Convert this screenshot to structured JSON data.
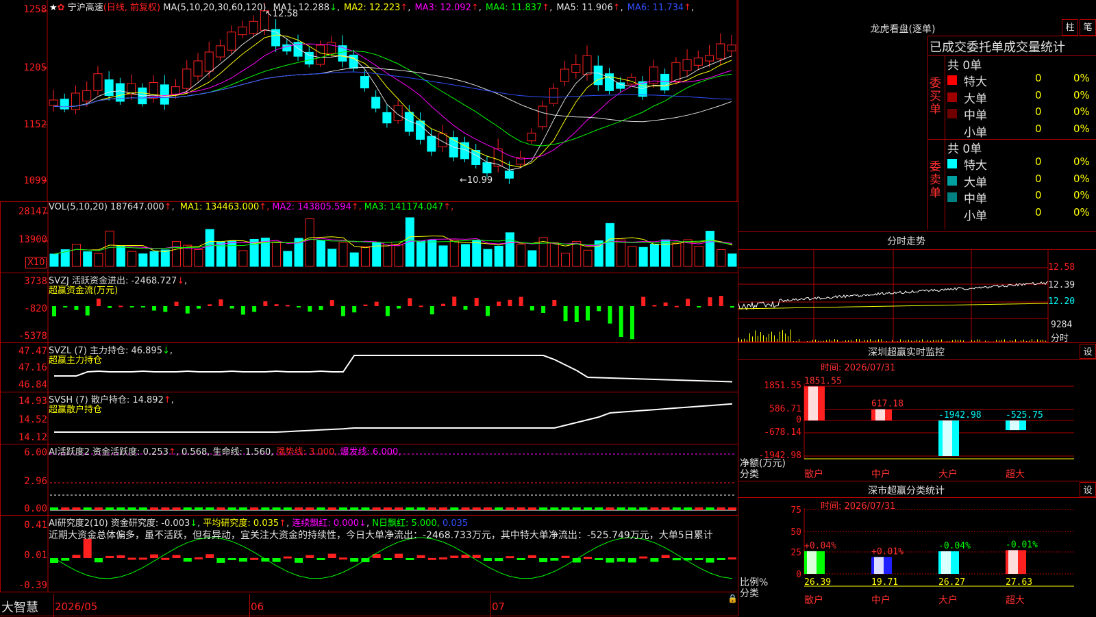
{
  "stock": {
    "name": "宁沪高速",
    "mode": "(日线, 前复权)",
    "ma_label": "MA(5,10,20,30,60,120)",
    "ma": [
      {
        "label": "MA1: 12.288",
        "arrow": "↓",
        "color": "#e0e0e0"
      },
      {
        "label": "MA2: 12.223",
        "arrow": "↑",
        "color": "#ffff00"
      },
      {
        "label": "MA3: 12.092",
        "arrow": "↑",
        "color": "#ff00ff"
      },
      {
        "label": "MA4: 11.837",
        "arrow": "↑",
        "color": "#00ff00"
      },
      {
        "label": "MA5: 11.906",
        "arrow": "↑",
        "color": "#e0e0e0"
      },
      {
        "label": "MA6: 11.734",
        "arrow": "↑",
        "color": "#3050ff"
      }
    ],
    "y_ticks": [
      "1258",
      "1205",
      "1152",
      "1099"
    ],
    "high_label": "12.58",
    "low_label": "←10.99"
  },
  "volume": {
    "header": "VOL(5,10,20)",
    "value": "187647.000",
    "ma": [
      {
        "label": "MA1: 134463.000",
        "color": "#ffff00"
      },
      {
        "label": "MA2: 143805.594",
        "color": "#ff00ff"
      },
      {
        "label": "MA3: 141174.047",
        "color": "#00ff00"
      }
    ],
    "y_ticks": [
      "28147",
      "13900"
    ],
    "unit": "X10"
  },
  "svzj": {
    "header": "SVZJ  活跃资金进出: -2468.727",
    "sub": "超赢资金流(万元)",
    "y_ticks": [
      "3738",
      "-820",
      "-5378"
    ]
  },
  "svzl": {
    "header": "SVZL (7) 主力持仓: 46.895",
    "sub": "超赢主力持仓",
    "y_ticks": [
      "47.47",
      "47.16",
      "46.84"
    ]
  },
  "svsh": {
    "header": "SVSH (7) 散户持仓: 14.892",
    "sub": "超赢散户持仓",
    "y_ticks": [
      "14.93",
      "14.52",
      "14.12"
    ]
  },
  "ai_active": {
    "header_a": "AI活跃度2 资金活跃度: 0.253",
    "header_b": "0.568, 生命线: 1.560,",
    "header_c": "强势线: 3.000,",
    "header_d": "爆发线: 6.000,",
    "y_ticks": [
      "6.00",
      "2.96",
      "0.00"
    ]
  },
  "ai_research": {
    "header_a": "AI研究度2(10) 资金研究度: -0.003",
    "header_b": "平均研究度: 0.035",
    "header_c": "连续飘红: 0.000",
    "header_d": "N日飘红: 5.000,",
    "header_e": "0.035",
    "commentary": "近期大资金总体偏多，虽不活跃，但有异动，宜关注大资金的持续性，今日大单净流出：-2468.733万元，其中特大单净流出：-525.749万元，大单5日累计",
    "y_ticks": [
      "0.41",
      "0.01",
      "-0.39"
    ]
  },
  "footer": {
    "brand": "大智慧",
    "dates": [
      "2026/05",
      "06",
      "07"
    ]
  },
  "right": {
    "longhu_title": "龙虎看盘(逐单)",
    "btn_bar": "柱",
    "btn_pen": "笔",
    "stats_title": "已成交委托单成交量统计",
    "buy_label": "委买单",
    "sell_label": "委卖单",
    "buy_total": "共 0单",
    "sell_total": "共 0单",
    "buy_rows": [
      {
        "name": "特大",
        "count": "0",
        "pct": "0%",
        "color": "#ff0000"
      },
      {
        "name": "大单",
        "count": "0",
        "pct": "0%",
        "color": "#a00000"
      },
      {
        "name": "中单",
        "count": "0",
        "pct": "0%",
        "color": "#700000"
      },
      {
        "name": "小单",
        "count": "0",
        "pct": "0%",
        "color": "#000000"
      }
    ],
    "sell_rows": [
      {
        "name": "特大",
        "count": "0",
        "pct": "0%",
        "color": "#00ffff"
      },
      {
        "name": "大单",
        "count": "0",
        "pct": "0%",
        "color": "#00a0a0"
      },
      {
        "name": "中单",
        "count": "0",
        "pct": "0%",
        "color": "#008080"
      },
      {
        "name": "小单",
        "count": "0",
        "pct": "0%",
        "color": "#000000"
      }
    ],
    "intraday_title": "分时走势",
    "intraday_ticks": [
      "12.58",
      "12.39",
      "12.20",
      "9284",
      "分时"
    ],
    "sz_monitor": {
      "title": "深圳超赢实时监控",
      "btn": "设",
      "time": "时间: 2026/07/31",
      "y_ticks": [
        "1851.55",
        "586.71",
        "0",
        "-678.14",
        "-1942.98"
      ],
      "unit_label": "净额(万元)",
      "cat_label": "分类",
      "bars": [
        {
          "name": "散户",
          "value": 1851.55,
          "label": "1851.55"
        },
        {
          "name": "中户",
          "value": 617.18,
          "label": "617.18"
        },
        {
          "name": "大户",
          "value": -1942.98,
          "label": "-1942.98"
        },
        {
          "name": "超大",
          "value": -525.75,
          "label": "-525.75"
        }
      ]
    },
    "sz_class": {
      "title": "深市超赢分类统计",
      "btn": "设",
      "time": "时间: 2026/07/31",
      "y_ticks": [
        "75",
        "50",
        "25",
        "0"
      ],
      "unit_label": "比例%",
      "cat_label": "分类",
      "bars": [
        {
          "name": "散户",
          "value": 26.39,
          "label": "26.39",
          "change": "+0.04%",
          "change_color": "#ff3030",
          "colors": [
            "#ffffff",
            "#00ff00"
          ]
        },
        {
          "name": "中户",
          "value": 19.71,
          "label": "19.71",
          "change": "+0.01%",
          "change_color": "#ff3030",
          "colors": [
            "#ffffff",
            "#2020ff"
          ]
        },
        {
          "name": "大户",
          "value": 26.27,
          "label": "26.27",
          "change": "-0.04%",
          "change_color": "#00ff00",
          "colors": [
            "#ffffff",
            "#00ffff"
          ]
        },
        {
          "name": "超大",
          "value": 27.63,
          "label": "27.63",
          "change": "-0.01%",
          "change_color": "#00ff00",
          "colors": [
            "#ffffff",
            "#ff2020"
          ]
        }
      ]
    }
  }
}
